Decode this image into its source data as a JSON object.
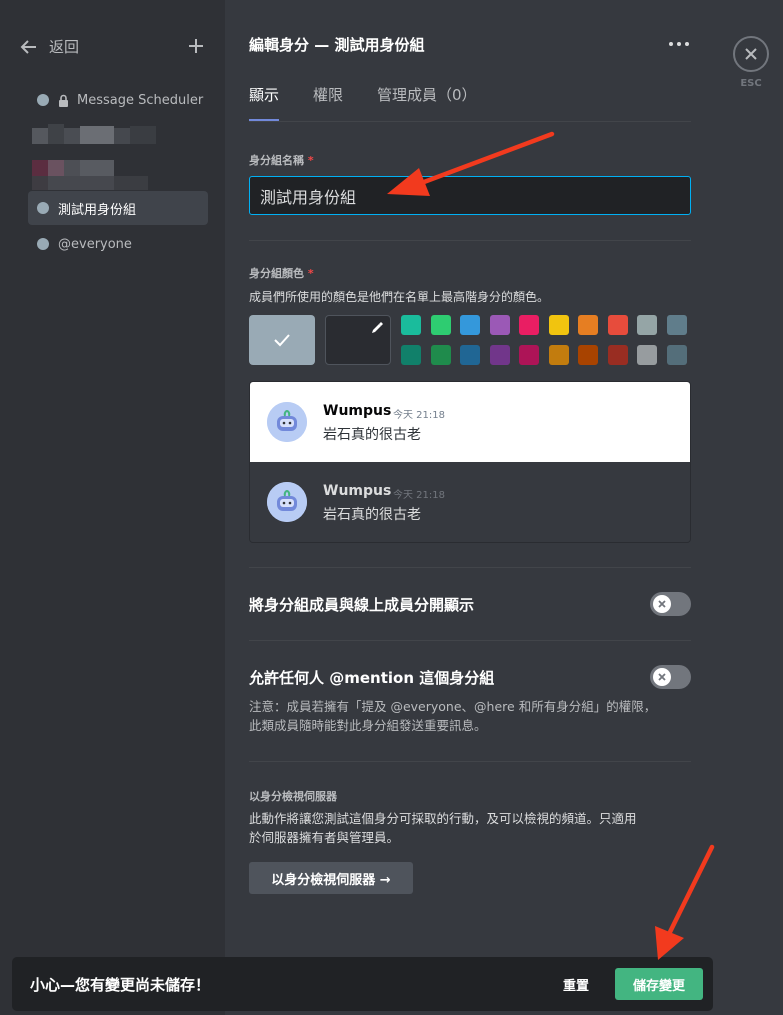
{
  "sidebar": {
    "back_label": "返回",
    "roles": [
      {
        "name": "Message Scheduler",
        "locked": true
      },
      {
        "name": "測試用身份組",
        "active": true
      },
      {
        "name": "@everyone"
      }
    ]
  },
  "header": {
    "title": "編輯身分 — 測試用身份組",
    "tabs": [
      "顯示",
      "權限",
      "管理成員（0）"
    ]
  },
  "close": {
    "esc_label": "ESC"
  },
  "form": {
    "name_label": "身分組名稱",
    "required_mark": "*",
    "name_value": "測試用身份組",
    "color_label": "身分組顏色",
    "color_desc": "成員們所使用的顏色是他們在名單上最高階身分的顏色。",
    "default_color": "#99aab5",
    "palette_row1": [
      "#1abc9c",
      "#2ecc71",
      "#3498db",
      "#9b59b6",
      "#e91e63",
      "#f1c40f",
      "#e67e22",
      "#e74c3c",
      "#95a5a6",
      "#607d8b"
    ],
    "palette_row2": [
      "#11806a",
      "#1f8b4c",
      "#206694",
      "#71368a",
      "#ad1457",
      "#c27c0e",
      "#a84300",
      "#992d22",
      "#979c9f",
      "#546e7a"
    ]
  },
  "preview": {
    "author": "Wumpus",
    "time": "今天 21:18",
    "message": "岩石真的很古老"
  },
  "settings": {
    "hoist_label": "將身分組成員與線上成員分開顯示",
    "mention_label": "允許任何人 @mention 這個身分組",
    "mention_note_1": "注意：成員若擁有「提及 @everyone、@here 和所有身分組」的權限，",
    "mention_note_2": "此類成員隨時能對此身分組發送重要訊息。",
    "view_as_heading": "以身分檢視伺服器",
    "view_as_desc_1": "此動作將讓您測試這個身分可採取的行動，及可以檢視的頻道。只適用",
    "view_as_desc_2": "於伺服器擁有者與管理員。",
    "view_as_button": "以身分檢視伺服器 →"
  },
  "unsaved": {
    "message": "小心—您有變更尚未儲存！",
    "reset_label": "重置",
    "save_label": "儲存變更"
  },
  "colors": {
    "accent": "#7289da",
    "focus": "#00b0f4",
    "save": "#43b581",
    "annotation_arrow": "#f23a1e"
  },
  "icons": [
    "arrow-left-icon",
    "plus-icon",
    "lock-icon",
    "more-icon",
    "close-icon",
    "check-icon",
    "eyedropper-icon",
    "x-icon",
    "wumpus-avatar-icon"
  ]
}
